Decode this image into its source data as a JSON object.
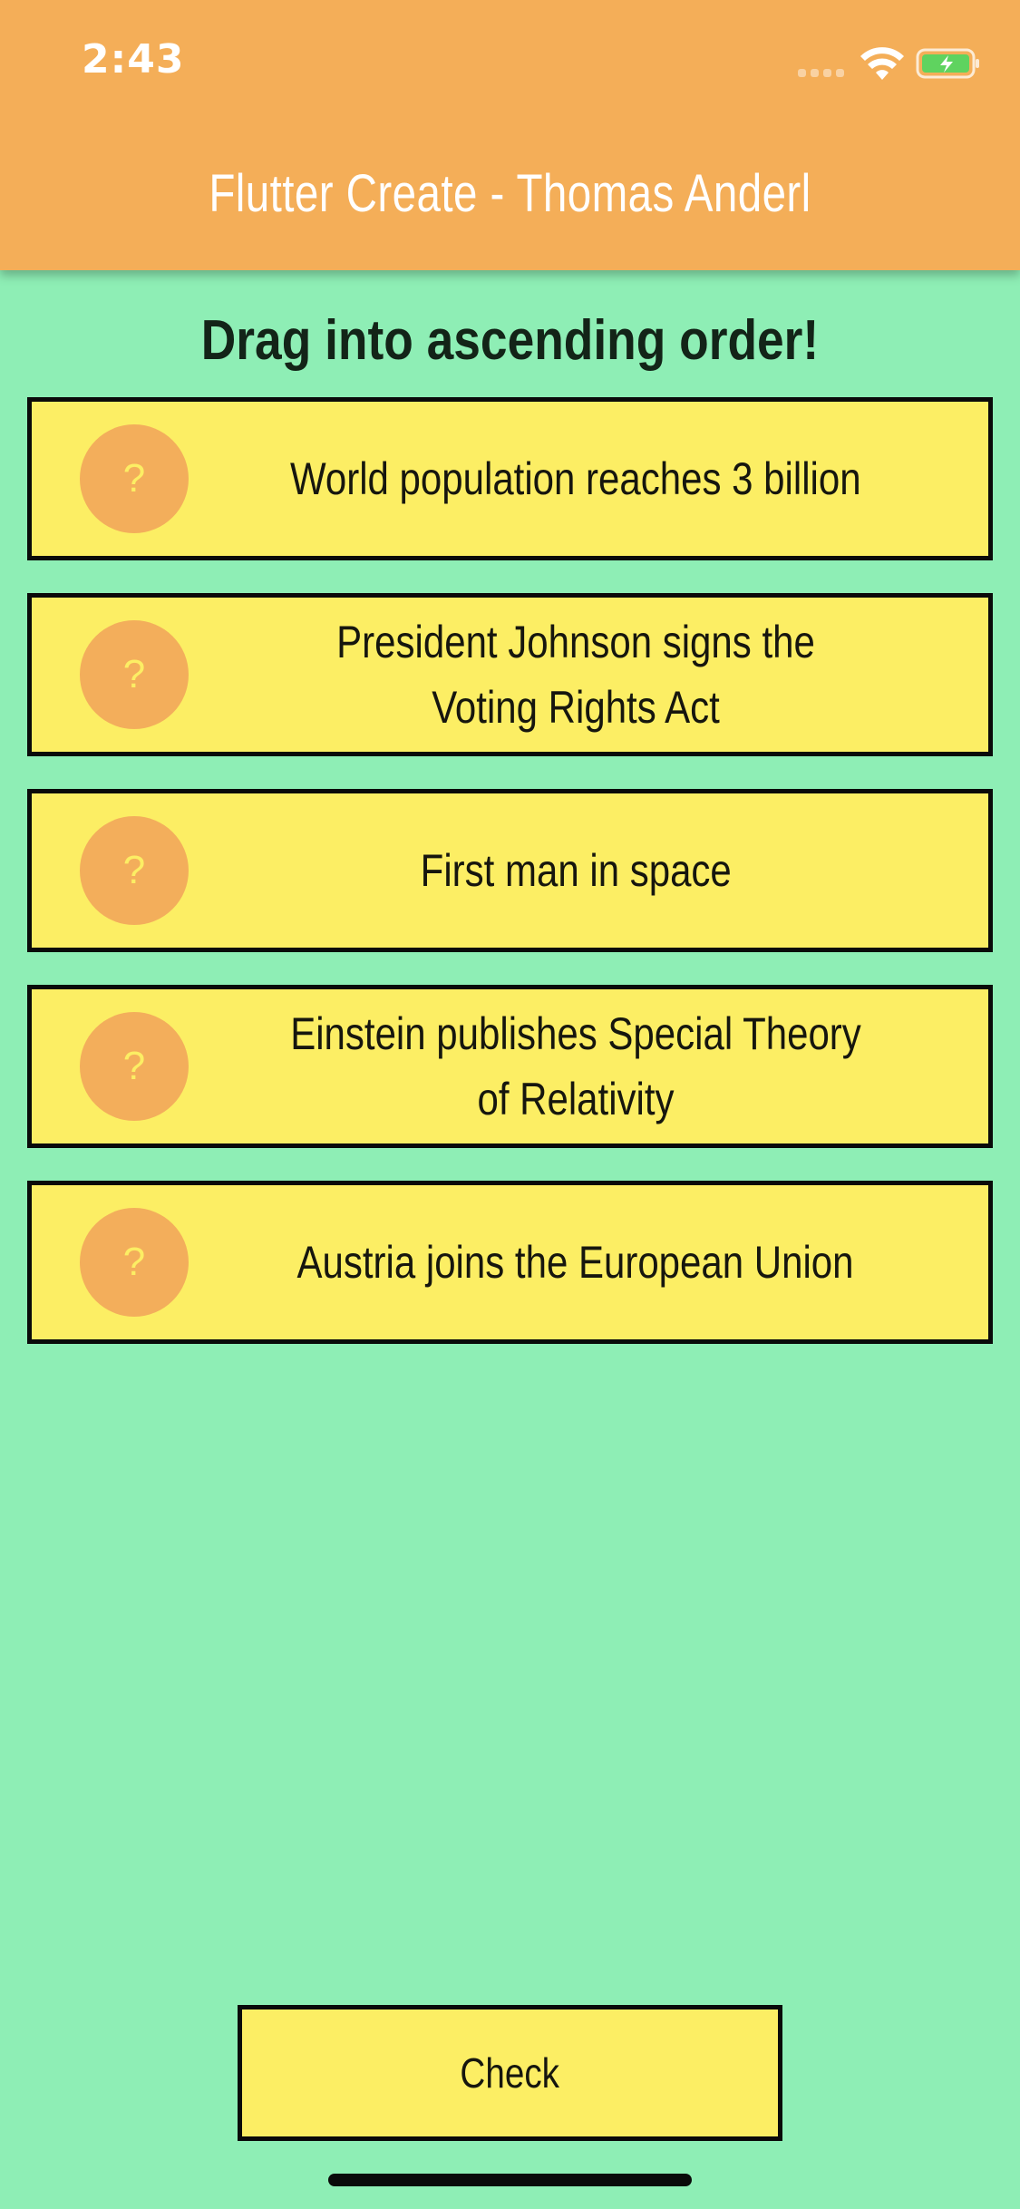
{
  "status_bar": {
    "time": "2:43",
    "icons": [
      "signal-dots-icon",
      "wifi-icon",
      "battery-charging-icon"
    ]
  },
  "app_bar": {
    "title": "Flutter Create - Thomas Anderl",
    "color": "#f4ae58"
  },
  "heading": "Drag into ascending order!",
  "items": [
    {
      "badge": "?",
      "text": "World population reaches 3 billion"
    },
    {
      "badge": "?",
      "text": "President Johnson signs the Voting Rights Act"
    },
    {
      "badge": "?",
      "text": "First man in space"
    },
    {
      "badge": "?",
      "text": "Einstein publishes Special Theory of Relativity"
    },
    {
      "badge": "?",
      "text": "Austria joins the European Union"
    }
  ],
  "check_button": {
    "label": "Check"
  },
  "colors": {
    "background": "#8eeeb5",
    "card": "#fcee64",
    "badge": "#f3ae5b",
    "border": "#0a0a0a"
  }
}
